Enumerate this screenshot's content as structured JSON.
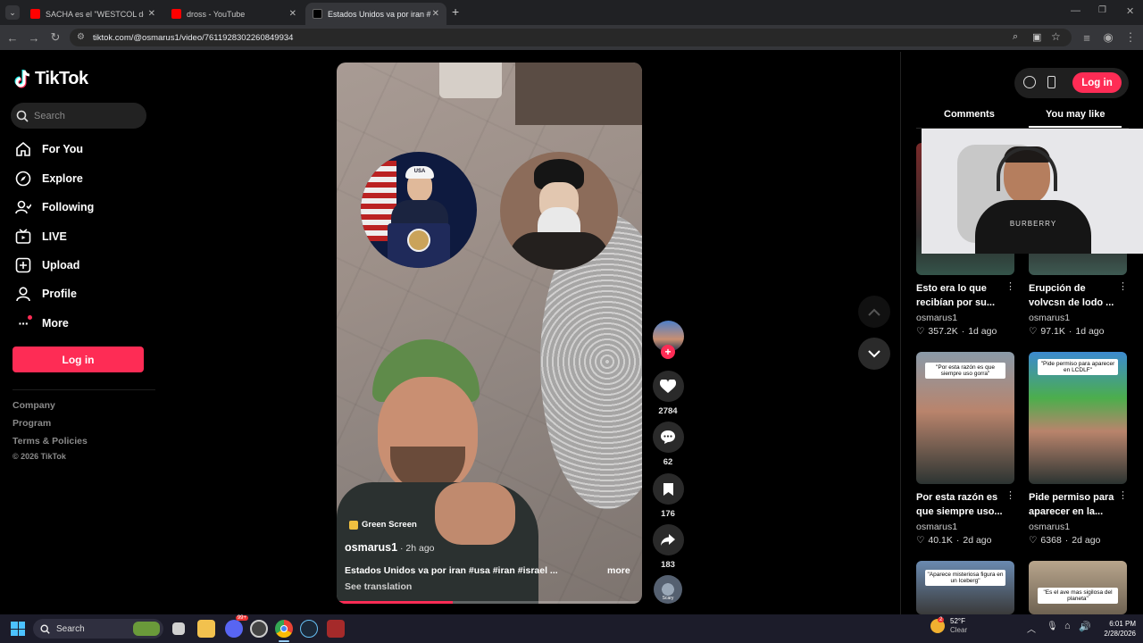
{
  "browser": {
    "tabs": [
      {
        "title": "SACHA es el \"WESTCOL de",
        "favicon_color": "#ff0000"
      },
      {
        "title": "dross - YouTube",
        "favicon_color": "#ff0000"
      },
      {
        "title": "Estados Unidos va por iran #us",
        "favicon_color": "#111111"
      }
    ],
    "url": "tiktok.com/@osmarus1/video/7611928302260849934"
  },
  "sidebar": {
    "logo": "TikTok",
    "search_placeholder": "Search",
    "items": [
      {
        "label": "For You",
        "icon": "home-icon"
      },
      {
        "label": "Explore",
        "icon": "compass-icon"
      },
      {
        "label": "Following",
        "icon": "following-icon"
      },
      {
        "label": "LIVE",
        "icon": "live-icon"
      },
      {
        "label": "Upload",
        "icon": "upload-icon"
      },
      {
        "label": "Profile",
        "icon": "profile-icon"
      },
      {
        "label": "More",
        "icon": "more-icon"
      }
    ],
    "login": "Log in",
    "footer": [
      "Company",
      "Program",
      "Terms & Policies",
      "© 2026 TikTok"
    ]
  },
  "video": {
    "badge": "Green Screen",
    "author": "osmarus1",
    "time": " · 2h ago",
    "caption": "Estados Unidos va por iran #usa #iran #israel ...",
    "more": "more",
    "see_translation": "See translation",
    "progress": 0.38,
    "overlay_cap_text": "USA"
  },
  "actions": {
    "likes": "2784",
    "comments": "62",
    "saves": "176",
    "shares": "183",
    "music_label": "Scary"
  },
  "right_panel": {
    "login": "Log in",
    "tabs": [
      "Comments",
      "You may like"
    ],
    "cards": [
      {
        "title": "Esto era lo que recibían por su...",
        "author": "osmarus1",
        "likes": "357.2K",
        "age": "1d ago",
        "caption": ""
      },
      {
        "title": "Erupción de volvcsn de lodo ...",
        "author": "osmarus1",
        "likes": "97.1K",
        "age": "1d ago",
        "caption": ""
      },
      {
        "title": "Por esta razón es que siempre uso...",
        "author": "osmarus1",
        "likes": "40.1K",
        "age": "2d ago",
        "caption": "\"Por esta razón es que siempre uso gorra\""
      },
      {
        "title": "Pide permiso para aparecer en la...",
        "author": "osmarus1",
        "likes": "6368",
        "age": "2d ago",
        "caption": "\"Pide permiso para aparecer en LCDLF\""
      },
      {
        "title": "",
        "author": "",
        "likes": "",
        "age": "",
        "caption": "\"Aparece misteriosa figura en un Iceberg\""
      },
      {
        "title": "",
        "author": "",
        "likes": "",
        "age": "",
        "caption": "\"Es el ave mas sigilosa del planeta\""
      }
    ]
  },
  "webcam": {
    "shirt_text": "BURBERRY"
  },
  "taskbar": {
    "search": "Search",
    "weather_temp": "52°F",
    "weather_desc": "Clear",
    "weather_badge": "2",
    "time": "6:01 PM",
    "date": "2/28/2026",
    "discord_badge": "99+"
  },
  "colors": {
    "accent": "#fe2c55"
  }
}
